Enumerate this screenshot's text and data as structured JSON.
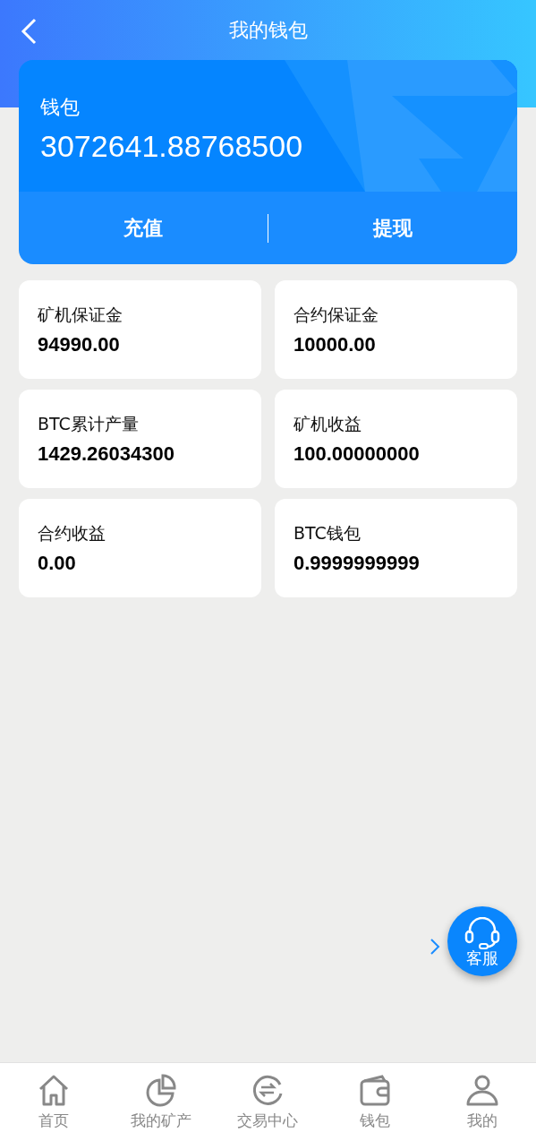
{
  "header": {
    "title": "我的钱包"
  },
  "wallet": {
    "label": "钱包",
    "balance": "3072641.88768500",
    "actions": [
      "充值",
      "提现"
    ]
  },
  "stats": [
    {
      "label": "矿机保证金",
      "value": "94990.00"
    },
    {
      "label": "合约保证金",
      "value": "10000.00"
    },
    {
      "label": "BTC累计产量",
      "value": "1429.26034300"
    },
    {
      "label": "矿机收益",
      "value": "100.00000000"
    },
    {
      "label": "合约收益",
      "value": "0.00"
    },
    {
      "label": "BTC钱包",
      "value": "0.9999999999"
    }
  ],
  "service": {
    "label": "客服"
  },
  "tabs": [
    {
      "label": "首页",
      "kind": "home",
      "selected": false
    },
    {
      "label": "我的矿产",
      "kind": "pie",
      "selected": false
    },
    {
      "label": "交易中心",
      "kind": "exchange",
      "selected": false
    },
    {
      "label": "钱包",
      "kind": "wallet",
      "selected": false
    },
    {
      "label": "我的",
      "kind": "user",
      "selected": false
    }
  ]
}
